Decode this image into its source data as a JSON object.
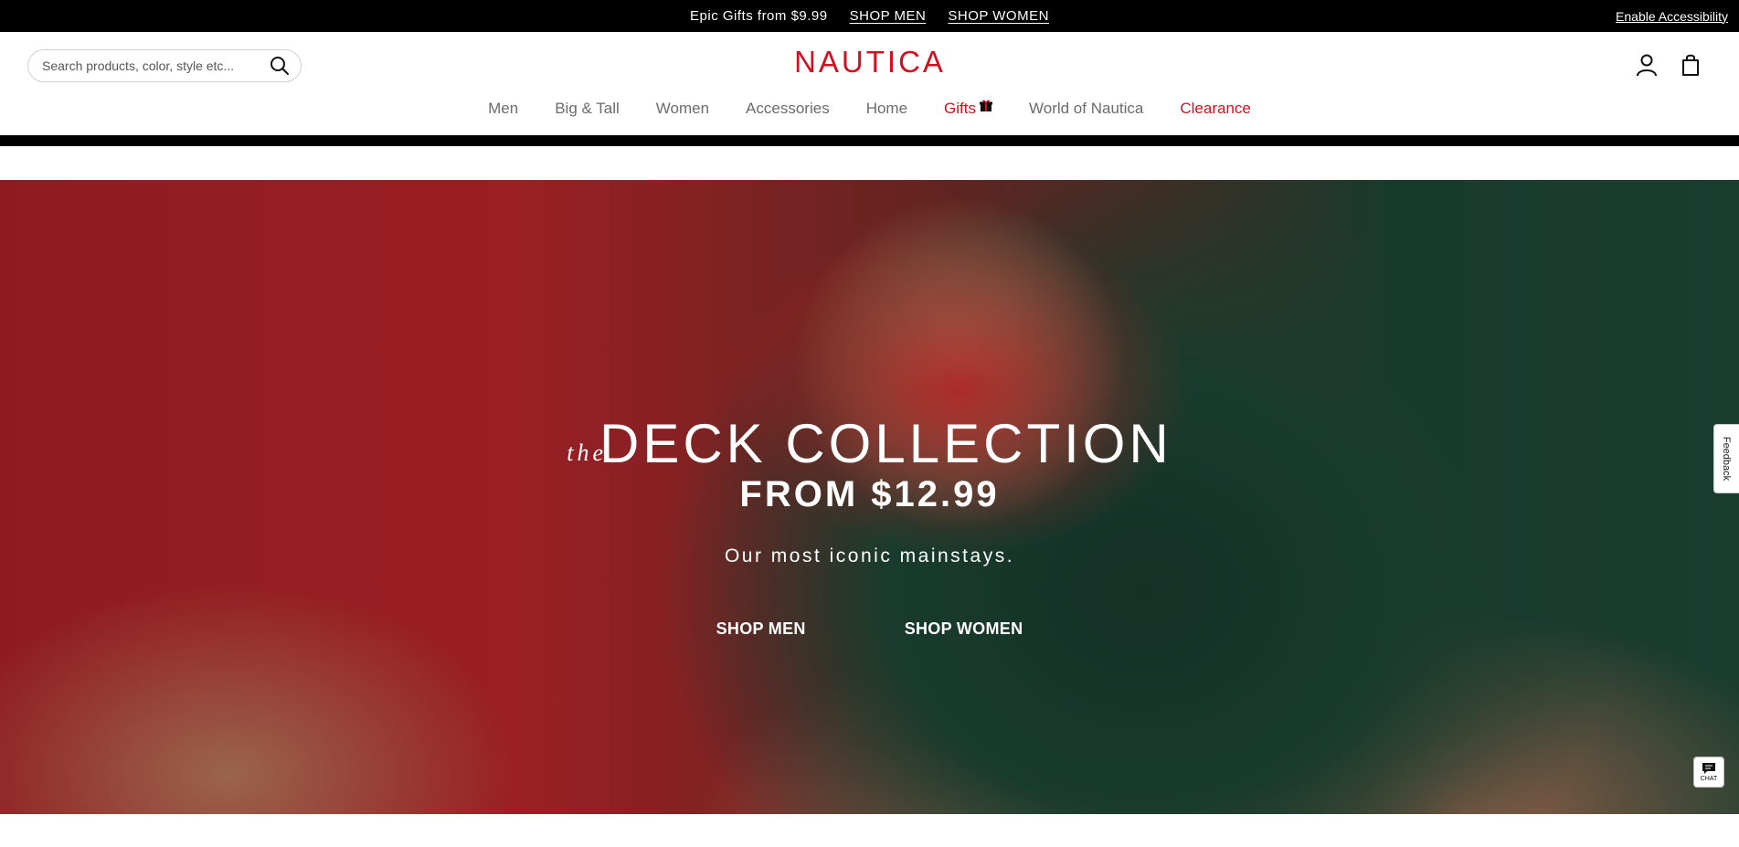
{
  "promo_bar": {
    "text": "Epic Gifts from $9.99",
    "link_men": "SHOP MEN",
    "link_women": "SHOP WOMEN",
    "accessibility": "Enable Accessibility"
  },
  "header": {
    "search_placeholder": "Search products, color, style etc...",
    "logo": "NAUTICA",
    "icons": [
      "search-icon",
      "account-icon",
      "bag-icon"
    ]
  },
  "nav": {
    "items": [
      {
        "label": "Men"
      },
      {
        "label": "Big & Tall"
      },
      {
        "label": "Women"
      },
      {
        "label": "Accessories"
      },
      {
        "label": "Home"
      },
      {
        "label": "Gifts"
      },
      {
        "label": "World of Nautica"
      },
      {
        "label": "Clearance"
      }
    ],
    "accent_color": "#d0111f"
  },
  "hero": {
    "title_prefix": "the",
    "title": "DECK COLLECTION",
    "price": "FROM $12.99",
    "subtitle": "Our most iconic mainstays.",
    "cta_men": "SHOP MEN",
    "cta_women": "SHOP WOMEN"
  },
  "feedback": {
    "label": "Feedback"
  },
  "chat": {
    "label": "CHAT"
  }
}
